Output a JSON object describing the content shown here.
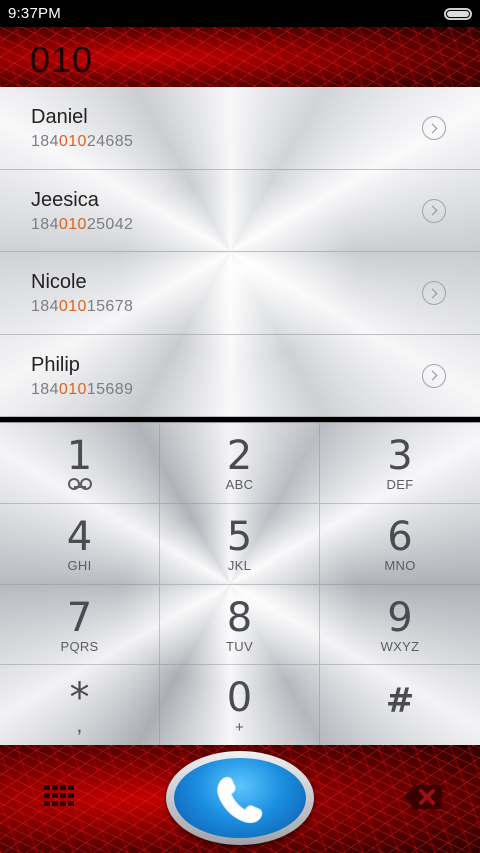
{
  "status": {
    "time": "9:37PM",
    "battery_level": 1.0
  },
  "dialer": {
    "number": "010"
  },
  "contacts": [
    {
      "name": "Daniel",
      "num_pre": "184",
      "num_match": "010",
      "num_post": "24685"
    },
    {
      "name": "Jeesica",
      "num_pre": "184",
      "num_match": "010",
      "num_post": "25042"
    },
    {
      "name": "Nicole",
      "num_pre": "184",
      "num_match": "010",
      "num_post": "15678"
    },
    {
      "name": "Philip",
      "num_pre": "184",
      "num_match": "010",
      "num_post": "15689"
    }
  ],
  "keys": [
    {
      "digit": "1",
      "sub": ""
    },
    {
      "digit": "2",
      "sub": "ABC"
    },
    {
      "digit": "3",
      "sub": "DEF"
    },
    {
      "digit": "4",
      "sub": "GHI"
    },
    {
      "digit": "5",
      "sub": "JKL"
    },
    {
      "digit": "6",
      "sub": "MNO"
    },
    {
      "digit": "7",
      "sub": "PQRS"
    },
    {
      "digit": "8",
      "sub": "TUV"
    },
    {
      "digit": "9",
      "sub": "WXYZ"
    },
    {
      "digit": "*",
      "sub": ","
    },
    {
      "digit": "0",
      "sub": "+"
    },
    {
      "digit": "#",
      "sub": ""
    }
  ],
  "icons": {
    "voicemail": "voicemail-icon",
    "dialpad": "dialpad-icon",
    "call": "phone-icon",
    "backspace": "backspace-icon",
    "chevron": "chevron-right-icon"
  },
  "colors": {
    "highlight": "#e0621d",
    "call_blue": "#1c8fe0",
    "background_red": "#b00000"
  }
}
